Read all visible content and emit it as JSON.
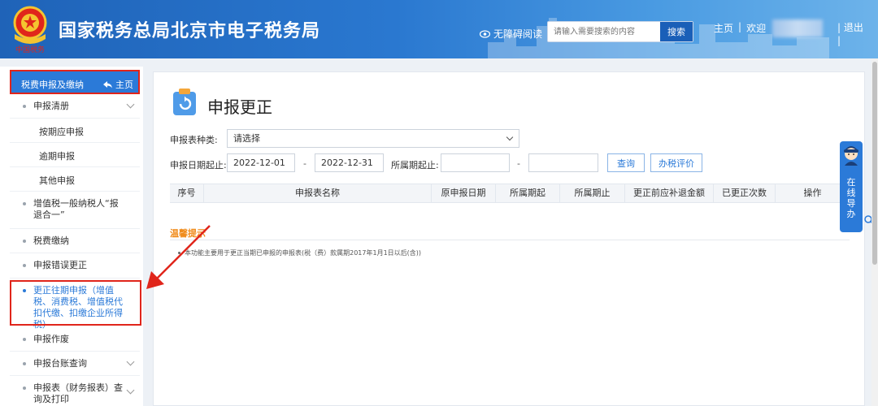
{
  "header": {
    "title": "国家税务总局北京市电子税务局",
    "emblem_caption": "中国税务",
    "accessibility": "无障碍阅读",
    "search_placeholder": "请输入需要搜索的内容",
    "search_button": "搜索",
    "home_link": "主页",
    "sep1": "|",
    "welcome": "欢迎",
    "sep2": "|",
    "logout": "退出"
  },
  "sidebar": {
    "header_label": "税费申报及缴纳",
    "home_label": "主页",
    "items": [
      {
        "label": "申报清册",
        "expandable": true
      },
      {
        "label": "按期应申报"
      },
      {
        "label": "逾期申报"
      },
      {
        "label": "其他申报"
      },
      {
        "label": "增值税一般纳税人“报退合一”"
      },
      {
        "label": "税费缴纳"
      },
      {
        "label": "申报错误更正"
      },
      {
        "label": "更正往期申报（增值税、消费税、增值税代扣代缴、扣缴企业所得税）",
        "highlighted": true
      },
      {
        "label": "申报作废"
      },
      {
        "label": "申报台账查询",
        "expandable": true
      },
      {
        "label": "申报表（财务报表）查询及打印",
        "expandable": true
      }
    ]
  },
  "main": {
    "title": "申报更正",
    "form": {
      "type_label": "申报表种类:",
      "type_value": "请选择",
      "date_label": "申报日期起止:",
      "date_from": "2022-12-01",
      "date_sep": "-",
      "date_to": "2022-12-31",
      "period_label": "所属期起止:",
      "period_from": "",
      "period_sep": "-",
      "period_to": "",
      "query_button": "查询",
      "rate_button": "办税评价"
    },
    "table": {
      "columns": [
        "序号",
        "申报表名称",
        "原申报日期",
        "所属期起",
        "所属期止",
        "更正前应补退金额",
        "已更正次数",
        "操作"
      ]
    },
    "tips": {
      "title": "温馨提示",
      "text": "本功能主要用于更正当期已申报的申报表(税（费）款属期2017年1月1日以后(含))"
    }
  },
  "online_help": {
    "label": "在线导办"
  },
  "colors": {
    "primary": "#2b7ad8",
    "header": "#2a78d0",
    "annotation_red": "#e0251b",
    "tips_orange": "#f08b1a"
  }
}
